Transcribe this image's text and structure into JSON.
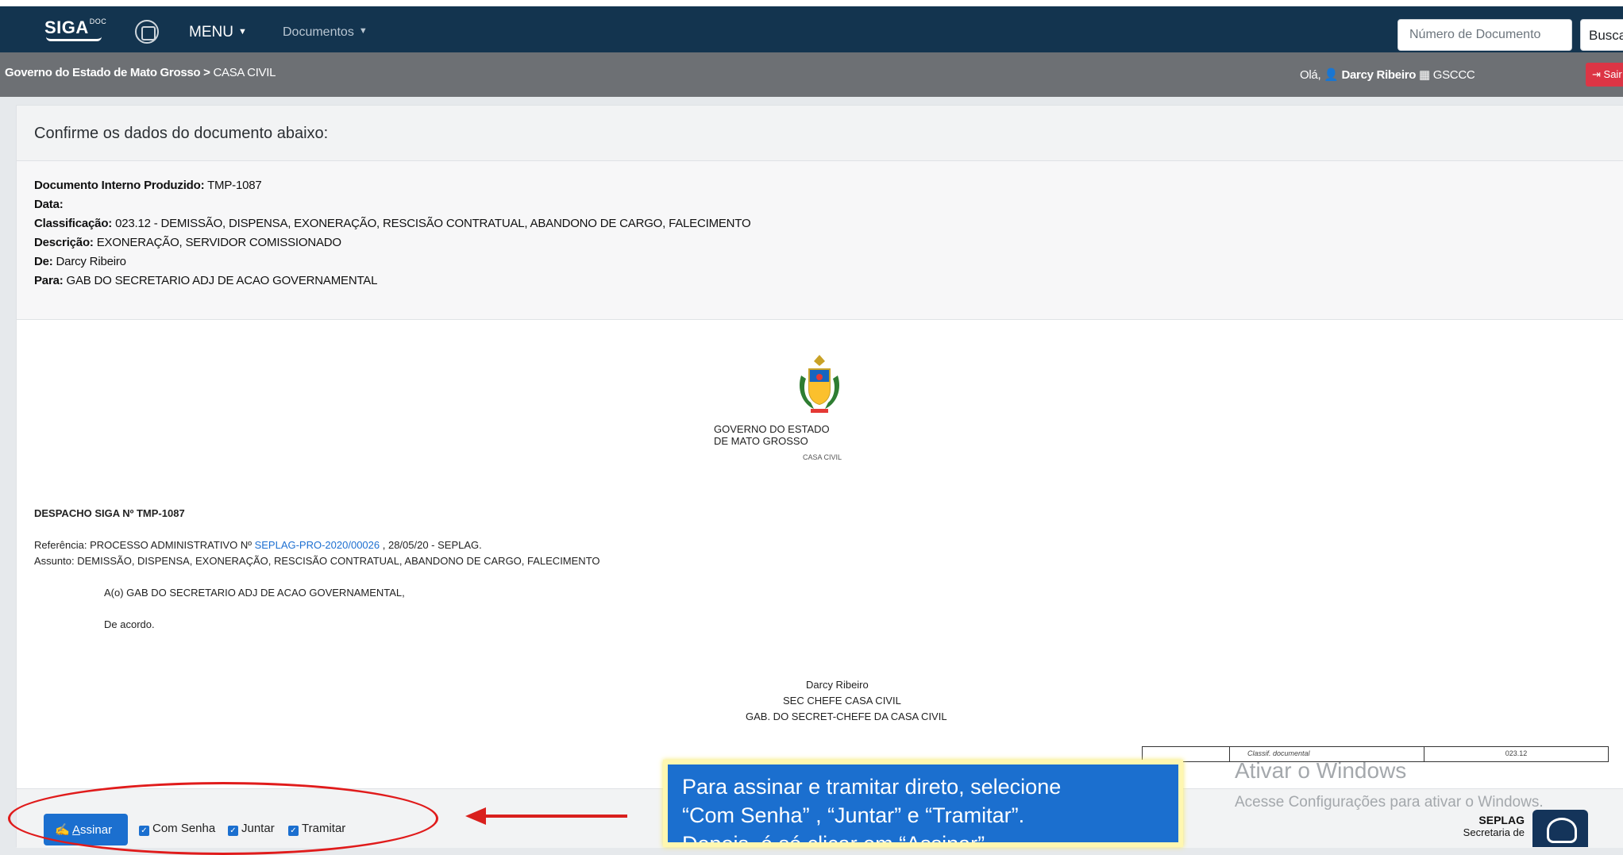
{
  "topbar": {
    "logo": "SIGA",
    "logo_sup": "DOC",
    "menu_label": "MENU",
    "documents_label": "Documentos",
    "doc_number_placeholder": "Número de Documento",
    "search_button": "Buscar"
  },
  "subbar": {
    "org": "Governo do Estado de Mato Grosso",
    "separator": " > ",
    "unit": "CASA CIVIL",
    "greeting": "Olá,",
    "user_name": "Darcy Ribeiro",
    "user_unit": "GSCCC",
    "logout": "Sair"
  },
  "card": {
    "header": "Confirme os dados do documento abaixo:"
  },
  "meta": {
    "doc_label": "Documento Interno Produzido:",
    "doc_value": "TMP-1087",
    "date_label": "Data:",
    "date_value": "",
    "class_label": "Classificação:",
    "class_value": "023.12 - DEMISSÃO, DISPENSA, EXONERAÇÃO, RESCISÃO CONTRATUAL, ABANDONO DE CARGO, FALECIMENTO",
    "desc_label": "Descrição:",
    "desc_value": "EXONERAÇÃO, SERVIDOR COMISSIONADO",
    "from_label": "De:",
    "from_value": "Darcy Ribeiro",
    "to_label": "Para:",
    "to_value": "GAB DO SECRETARIO ADJ DE ACAO GOVERNAMENTAL"
  },
  "document": {
    "gov": "GOVERNO DO ESTADO DE MATO GROSSO",
    "unit": "CASA CIVIL",
    "title": "DESPACHO SIGA Nº TMP-1087",
    "ref_prefix": "Referência: PROCESSO ADMINISTRATIVO Nº ",
    "ref_link": "SEPLAG-PRO-2020/00026",
    "ref_suffix": " , 28/05/20 - SEPLAG.",
    "subject": "Assunto: DEMISSÃO, DISPENSA, EXONERAÇÃO, RESCISÃO CONTRATUAL, ABANDONO DE CARGO, FALECIMENTO",
    "addressee": "A(o) GAB DO SECRETARIO ADJ DE ACAO GOVERNAMENTAL,",
    "body": "De acordo.",
    "signer_name": "Darcy Ribeiro",
    "signer_role": "SEC CHEFE CASA CIVIL",
    "signer_unit": "GAB. DO SECRET-CHEFE DA CASA CIVIL",
    "classif_label": "Classif. documental",
    "classif_value": "023.12"
  },
  "footer": {
    "sign_button_prefix": "",
    "sign_button_underlined": "A",
    "sign_button_rest": "ssinar",
    "check_password": "Com Senha",
    "check_join": "Juntar",
    "check_send": "Tramitar"
  },
  "overlay": {
    "callout_line1": "Para assinar e tramitar direto, selecione",
    "callout_line2": "“Com Senha” , “Juntar” e “Tramitar”.",
    "callout_line3": "Depois, é só clicar em “Assinar”.",
    "watermark_title": "Ativar o Windows",
    "watermark_sub": "Acesse Configurações para ativar o Windows.",
    "seplag_name": "SEPLAG",
    "seplag_sub": "Secretaria de"
  },
  "colors": {
    "topbar": "#13344f",
    "subbar": "#6d7074",
    "primary": "#1b6fcf",
    "danger": "#dc3545",
    "annotation": "#e01b1b"
  }
}
